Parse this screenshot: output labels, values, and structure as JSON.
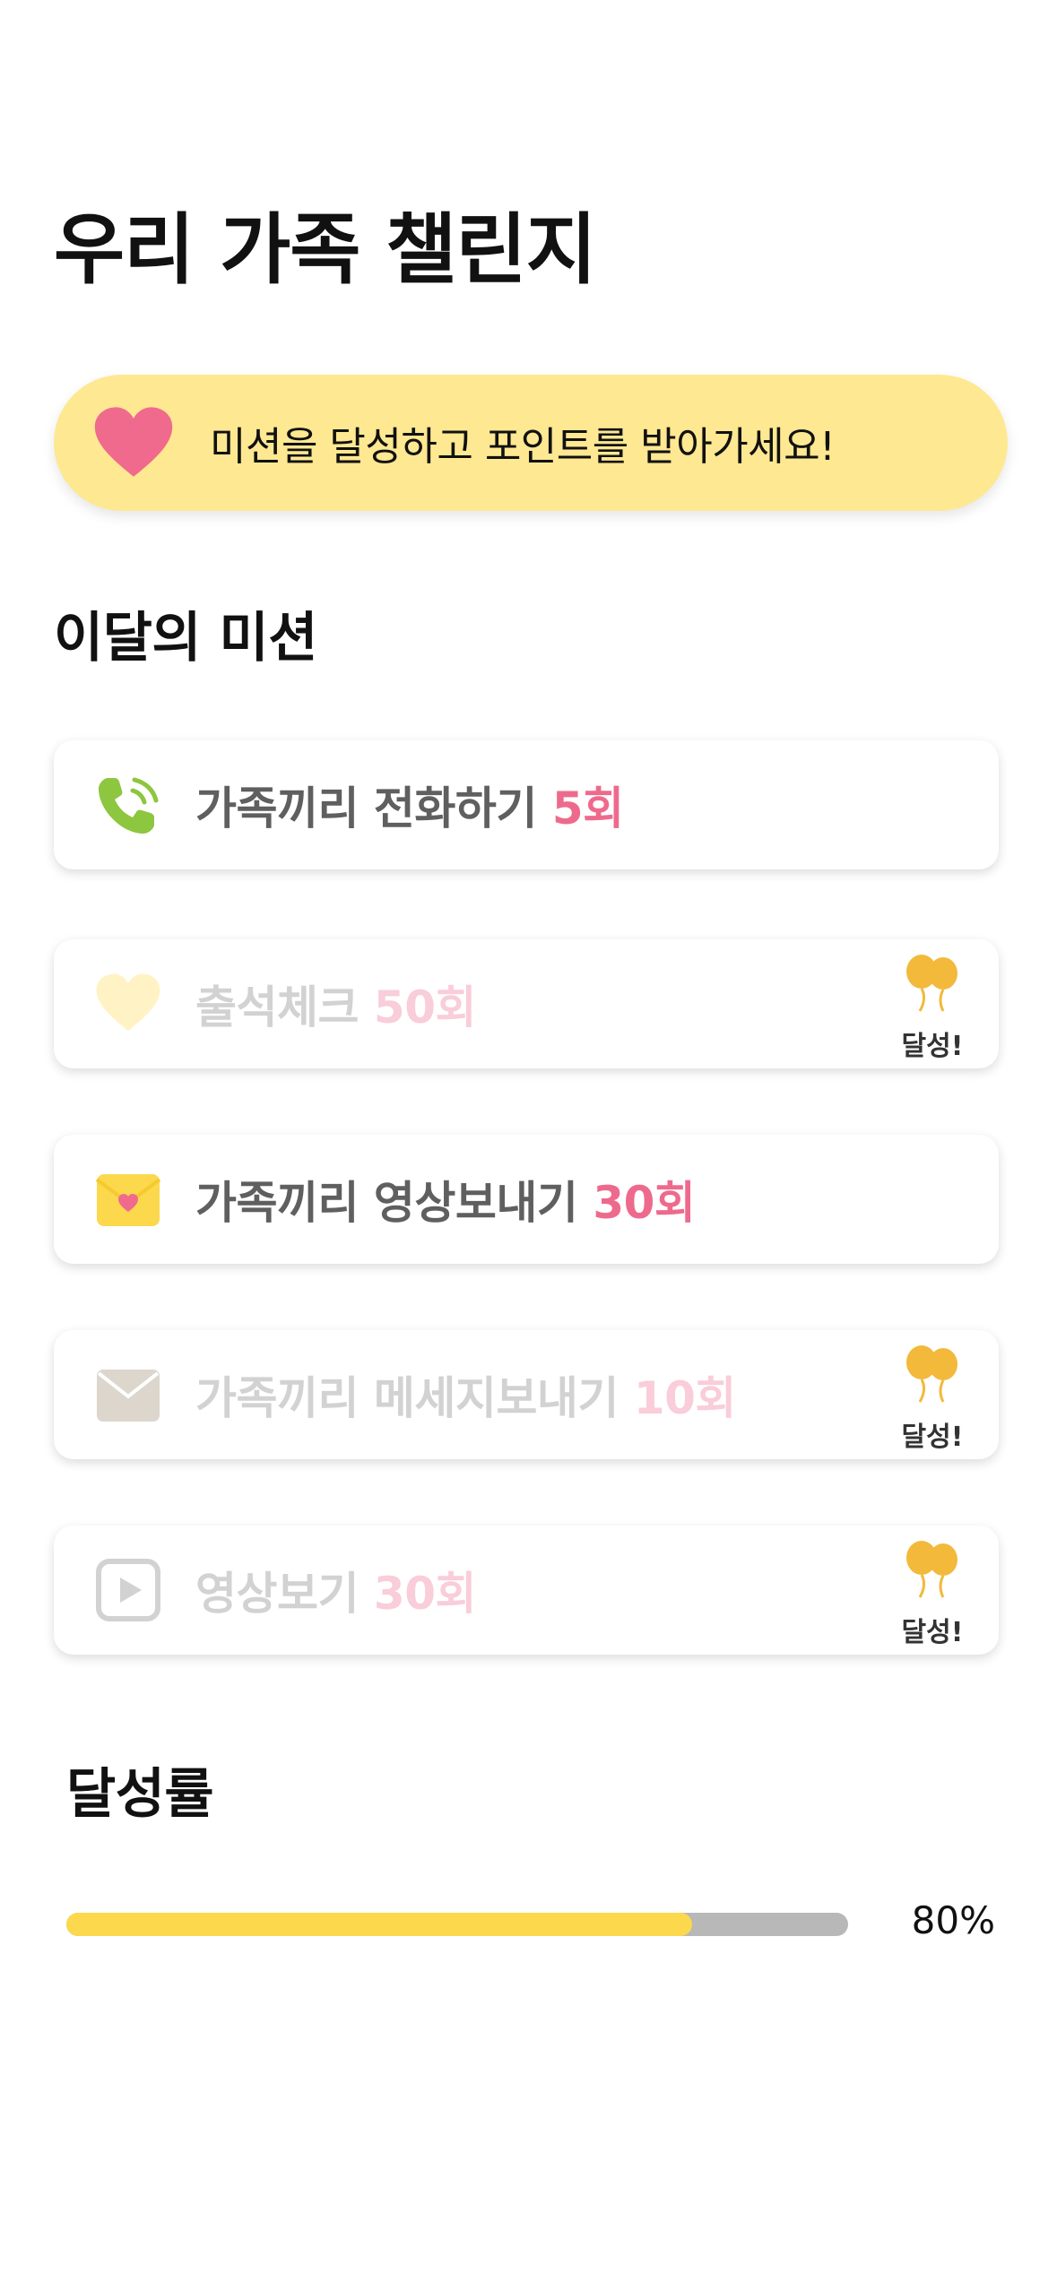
{
  "header": {
    "title": "우리 가족 챌린지"
  },
  "banner": {
    "icon": "heart-icon",
    "text": "미션을 달성하고 포인트를 받아가세요!"
  },
  "missions_section": {
    "title": "이달의 미션",
    "done_label": "달성!",
    "items": [
      {
        "icon": "phone-icon",
        "label": "가족끼리 전화하기",
        "count": "5회",
        "completed": false
      },
      {
        "icon": "heart-icon",
        "label": "출석체크",
        "count": "50회",
        "completed": true
      },
      {
        "icon": "envelope-heart-icon",
        "label": "가족끼리 영상보내기",
        "count": "30회",
        "completed": false
      },
      {
        "icon": "envelope-icon",
        "label": "가족끼리 메세지보내기",
        "count": "10회",
        "completed": true
      },
      {
        "icon": "play-icon",
        "label": "영상보기",
        "count": "30회",
        "completed": true
      }
    ]
  },
  "achievement": {
    "title": "달성률",
    "percent": 80,
    "percent_label": "80%"
  },
  "colors": {
    "banner_bg": "#fee891",
    "accent_pink": "#ee6a8d",
    "accent_yellow": "#fcd84c",
    "phone_green": "#8dc63f",
    "badge_gold": "#f2b93b"
  }
}
